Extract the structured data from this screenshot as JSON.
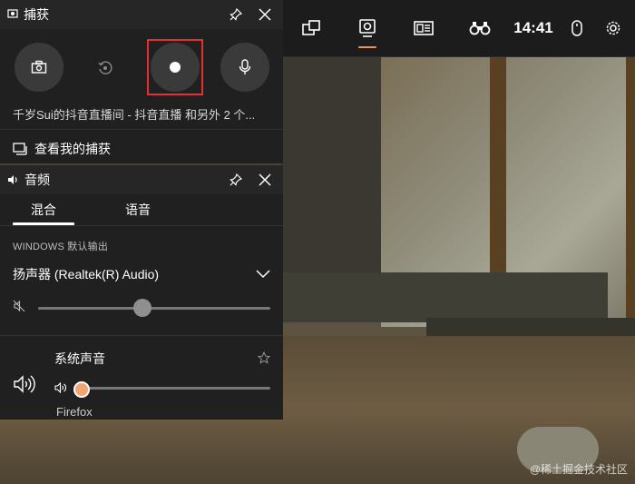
{
  "colors": {
    "accent": "#e89559",
    "record_highlight": "#e0302f",
    "panel_bg": "#202020",
    "slider_knob_orange": "#f0a472"
  },
  "topbar": {
    "time": "14:41",
    "items": [
      {
        "icon": "widget-menu-icon"
      },
      {
        "icon": "capture-webcam-icon",
        "active": true
      },
      {
        "icon": "performance-icon"
      },
      {
        "icon": "binoculars-icon"
      },
      {
        "icon": "mouse-icon"
      },
      {
        "icon": "settings-gear-icon"
      }
    ]
  },
  "capture": {
    "title": "捕获",
    "source": "千岁Sui的抖音直播间 - 抖音直播 和另外 2 个...",
    "view_captures": "查看我的捕获",
    "buttons": [
      "screenshot-icon",
      "record-last-icon",
      "record-icon",
      "microphone-icon"
    ]
  },
  "audio": {
    "title": "音频",
    "tabs": [
      "混合",
      "语音"
    ],
    "active_tab": 0,
    "output_caption": "WINDOWS 默认输出",
    "device": "扬声器 (Realtek(R) Audio)",
    "master_volume": 0.45,
    "app": {
      "name": "系统声音",
      "volume": 0.0
    },
    "next_app_partial": "Firefox"
  },
  "watermark": "@稀土掘金技术社区"
}
